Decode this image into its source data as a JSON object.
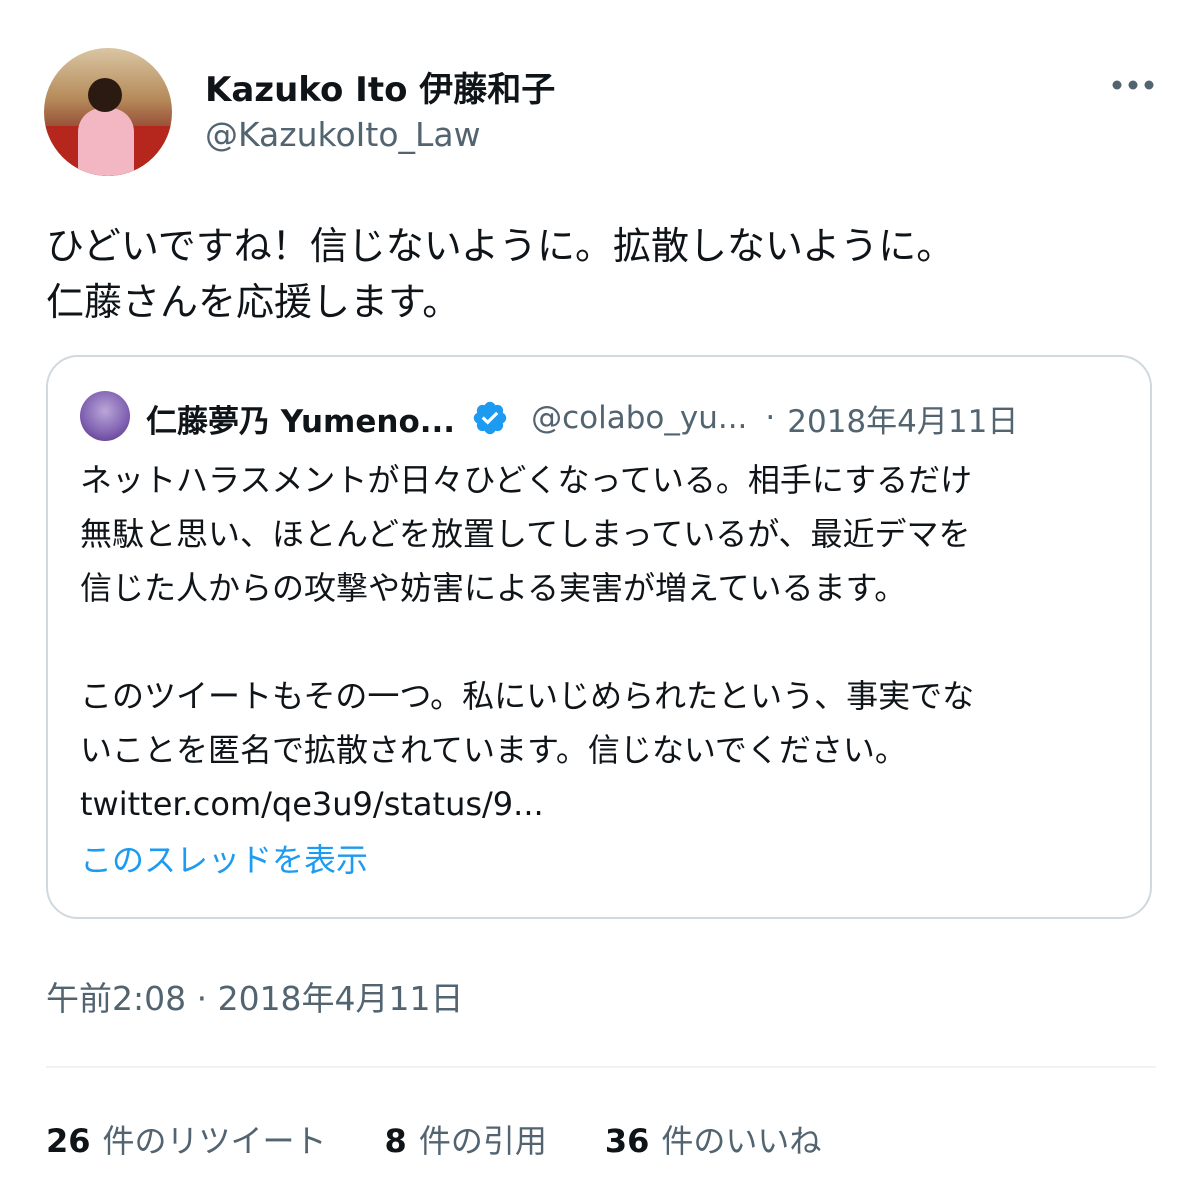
{
  "author": {
    "name": "Kazuko Ito 伊藤和子",
    "handle": "@KazukoIto_Law"
  },
  "tweet": {
    "lines": [
      "ひどいですね！信じないように。拡散しないように。",
      "仁藤さんを応援します。"
    ],
    "timestamp": "午前2:08 · 2018年4月11日"
  },
  "quoted": {
    "name": "仁藤夢乃 Yumeno...",
    "handle": "@colabo_yu...",
    "separator": "·",
    "date": "2018年4月11日",
    "lines": [
      "ネットハラスメントが日々ひどくなっている。相手にするだけ",
      "無駄と思い、ほとんどを放置してしまっているが、最近デマを",
      "信じた人からの攻撃や妨害による実害が増えているます。",
      "",
      "このツイートもその一つ。私にいじめられたという、事実でな",
      "いことを匿名で拡散されています。信じないでください。",
      "twitter.com/qe3u9/status/9..."
    ],
    "thread_link": "このスレッドを表示"
  },
  "stats": {
    "retweets": {
      "count": "26",
      "label": "件のリツイート"
    },
    "quotes": {
      "count": "8",
      "label": "件の引用"
    },
    "likes": {
      "count": "36",
      "label": "件のいいね"
    }
  },
  "icons": {
    "more": "more-icon",
    "verified": "verified-icon"
  },
  "colors": {
    "text": "#0f1419",
    "secondary": "#536471",
    "link": "#1d9bf0",
    "border": "#cfd9de"
  }
}
